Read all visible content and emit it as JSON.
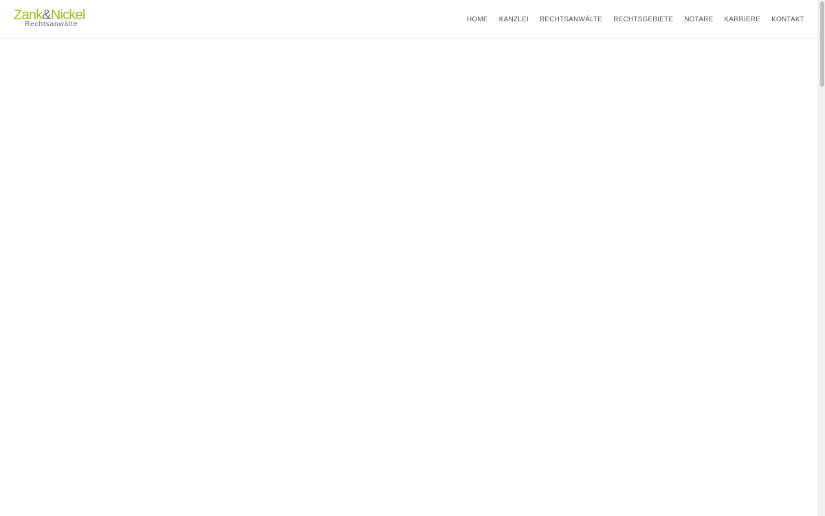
{
  "logo": {
    "part_a": "Zank",
    "amp": "&",
    "part_b": "Nickel",
    "subtitle": "Rechtsanwälte",
    "colors": {
      "green": "#9cc127",
      "gray": "#6d6e70"
    }
  },
  "nav": {
    "items": [
      {
        "label": "HOME"
      },
      {
        "label": "KANZLEI"
      },
      {
        "label": "RECHTSANWÄLTE"
      },
      {
        "label": "RECHTSGEBIETE"
      },
      {
        "label": "NOTARE"
      },
      {
        "label": "KARRIERE"
      },
      {
        "label": "KONTAKT"
      }
    ]
  }
}
